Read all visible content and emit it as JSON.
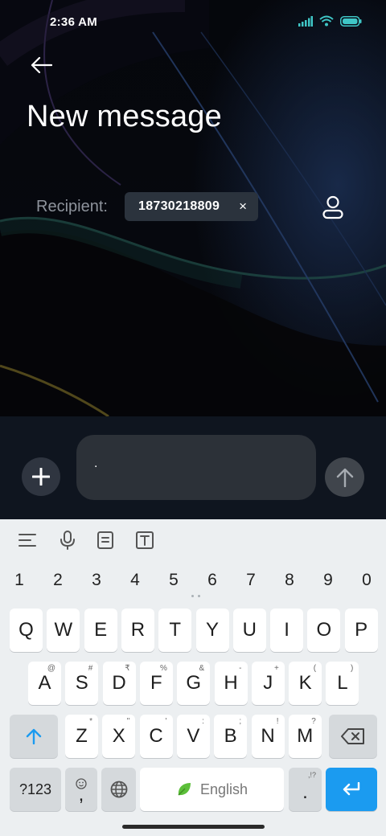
{
  "status_bar": {
    "time": "2:36 AM"
  },
  "header": {
    "title": "New message"
  },
  "recipient": {
    "label": "Recipient:",
    "chip_number": "18730218809",
    "chip_close": "×"
  },
  "compose": {
    "message_value": "."
  },
  "keyboard": {
    "numbers": [
      "1",
      "2",
      "3",
      "4",
      "5",
      "6",
      "7",
      "8",
      "9",
      "0"
    ],
    "row1": [
      {
        "k": "Q",
        "h": ""
      },
      {
        "k": "W",
        "h": ""
      },
      {
        "k": "E",
        "h": ""
      },
      {
        "k": "R",
        "h": ""
      },
      {
        "k": "T",
        "h": ""
      },
      {
        "k": "Y",
        "h": ""
      },
      {
        "k": "U",
        "h": ""
      },
      {
        "k": "I",
        "h": ""
      },
      {
        "k": "O",
        "h": ""
      },
      {
        "k": "P",
        "h": ""
      }
    ],
    "row2": [
      {
        "k": "A",
        "h": "@"
      },
      {
        "k": "S",
        "h": "#"
      },
      {
        "k": "D",
        "h": "₹"
      },
      {
        "k": "F",
        "h": "%"
      },
      {
        "k": "G",
        "h": "&"
      },
      {
        "k": "H",
        "h": "-"
      },
      {
        "k": "J",
        "h": "+"
      },
      {
        "k": "K",
        "h": "("
      },
      {
        "k": "L",
        "h": ")"
      }
    ],
    "row3": [
      {
        "k": "Z",
        "h": "*"
      },
      {
        "k": "X",
        "h": "\""
      },
      {
        "k": "C",
        "h": "'"
      },
      {
        "k": "V",
        "h": ":"
      },
      {
        "k": "B",
        "h": ";"
      },
      {
        "k": "N",
        "h": "!"
      },
      {
        "k": "M",
        "h": "?"
      }
    ],
    "symbols_label": "?123",
    "comma_label": ",",
    "space_label": "English",
    "period_label": ".",
    "period_hint": ",!?"
  },
  "colors": {
    "accent_blue": "#1b9bf0",
    "signal_teal": "#3fc6c6",
    "chip_bg": "#2b333d"
  }
}
